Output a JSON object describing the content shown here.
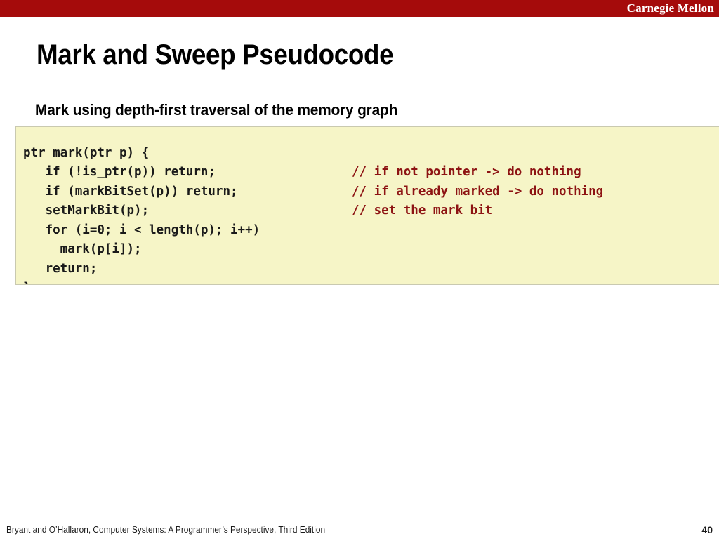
{
  "brand": {
    "institution": "Carnegie Mellon",
    "bar_color": "#a50b0b"
  },
  "slide": {
    "title": "Mark and Sweep Pseudocode",
    "subtitle": "Mark using depth-first traversal of the memory graph"
  },
  "code_block": {
    "background_color": "#f6f5c7",
    "border_color": "#c9c9b0",
    "code_color": "#1a1a1a",
    "comment_color": "#8d1313",
    "lines": [
      "ptr mark(ptr p) {",
      "   if (!is_ptr(p)) return;",
      "   if (markBitSet(p)) return;",
      "   setMarkBit(p);",
      "   for (i=0; i < length(p); i++)",
      "     mark(p[i]);",
      "   return;",
      "}"
    ],
    "comments": [
      "",
      "// if not pointer -> do nothing",
      "// if already marked -> do nothing",
      "// set the mark bit",
      "",
      "",
      "",
      ""
    ]
  },
  "footer": {
    "citation": "Bryant and O’Hallaron, Computer Systems: A Programmer’s Perspective, Third Edition",
    "page_number": "40"
  }
}
